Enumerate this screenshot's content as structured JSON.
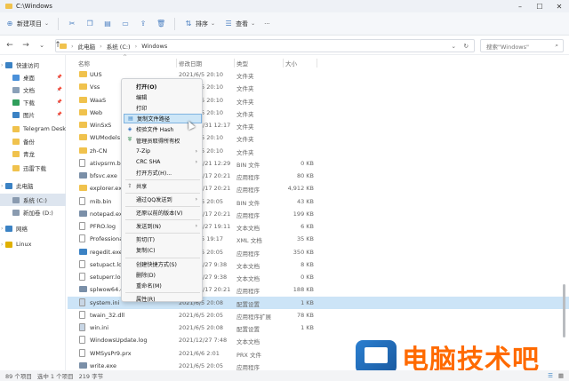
{
  "window": {
    "title": "C:\\Windows"
  },
  "toolbar": {
    "new_label": "新建项目",
    "sort_label": "排序",
    "view_label": "查看"
  },
  "address": {
    "crumbs": [
      "此电脑",
      "系统 (C:)",
      "Windows"
    ],
    "search_placeholder": "搜索\"Windows\""
  },
  "columns": {
    "name": "名称",
    "date": "修改日期",
    "type": "类型",
    "size": "大小"
  },
  "sidebar": [
    {
      "label": "快速访问",
      "icon": "star-icon",
      "color": "#3b82c4",
      "pin": false,
      "indent": 0
    },
    {
      "label": "桌面",
      "icon": "desktop-icon",
      "color": "#4a90d9",
      "pin": true,
      "indent": 1
    },
    {
      "label": "文档",
      "icon": "document-icon",
      "color": "#8aa0b8",
      "pin": true,
      "indent": 1
    },
    {
      "label": "下载",
      "icon": "download-icon",
      "color": "#2f9e5b",
      "pin": true,
      "indent": 1
    },
    {
      "label": "图片",
      "icon": "picture-icon",
      "color": "#3b82c4",
      "pin": true,
      "indent": 1
    },
    {
      "label": "Telegram Deskto",
      "icon": "folder-icon",
      "color": "#f0c24d",
      "pin": false,
      "indent": 1
    },
    {
      "label": "备份",
      "icon": "folder-icon",
      "color": "#f0c24d",
      "pin": false,
      "indent": 1
    },
    {
      "label": "青龙",
      "icon": "folder-icon",
      "color": "#f0c24d",
      "pin": false,
      "indent": 1
    },
    {
      "label": "迅雷下载",
      "icon": "folder-icon",
      "color": "#f0c24d",
      "pin": false,
      "indent": 1
    },
    {
      "label": "此电脑",
      "icon": "computer-icon",
      "color": "#3b82c4",
      "pin": false,
      "indent": 0
    },
    {
      "label": "系统 (C:)",
      "icon": "drive-icon",
      "color": "#8a9bb0",
      "pin": false,
      "indent": 1,
      "selected": true
    },
    {
      "label": "新加卷 (D:)",
      "icon": "drive-icon",
      "color": "#8a9bb0",
      "pin": false,
      "indent": 1
    },
    {
      "label": "网络",
      "icon": "network-icon",
      "color": "#3b82c4",
      "pin": false,
      "indent": 0
    },
    {
      "label": "Linux",
      "icon": "linux-icon",
      "color": "#e0b000",
      "pin": false,
      "indent": 0
    }
  ],
  "files": [
    {
      "name": "UUS",
      "date": "2021/6/5 20:10",
      "type": "文件夹",
      "size": "",
      "icon": "folder"
    },
    {
      "name": "Vss",
      "date": "2021/6/5 20:10",
      "type": "文件夹",
      "size": "",
      "icon": "folder"
    },
    {
      "name": "WaaS",
      "date": "2021/6/5 20:10",
      "type": "文件夹",
      "size": "",
      "icon": "folder"
    },
    {
      "name": "Web",
      "date": "2021/6/5 20:10",
      "type": "文件夹",
      "size": "",
      "icon": "folder"
    },
    {
      "name": "WinSxS",
      "date": "2021/12/31 12:17",
      "type": "文件夹",
      "size": "",
      "icon": "folder"
    },
    {
      "name": "WUModels",
      "date": "2021/6/5 20:10",
      "type": "文件夹",
      "size": "",
      "icon": "folder"
    },
    {
      "name": "zh-CN",
      "date": "2021/6/5 20:10",
      "type": "文件夹",
      "size": "",
      "icon": "folder"
    },
    {
      "name": "ativpsrm.bin",
      "date": "2021/12/21 12:29",
      "type": "BIN 文件",
      "size": "0 KB",
      "icon": "file"
    },
    {
      "name": "bfsvc.exe",
      "date": "2021/12/17 20:21",
      "type": "应用程序",
      "size": "80 KB",
      "icon": "exe"
    },
    {
      "name": "explorer.exe",
      "date": "2021/12/17 20:21",
      "type": "应用程序",
      "size": "4,912 KB",
      "icon": "explorer"
    },
    {
      "name": "mib.bin",
      "date": "2021/6/5 20:05",
      "type": "BIN 文件",
      "size": "43 KB",
      "icon": "file"
    },
    {
      "name": "notepad.exe",
      "date": "2021/12/17 20:21",
      "type": "应用程序",
      "size": "199 KB",
      "icon": "exe"
    },
    {
      "name": "PFRO.log",
      "date": "2021/12/27 19:11",
      "type": "文本文档",
      "size": "6 KB",
      "icon": "file"
    },
    {
      "name": "Professional.xml",
      "date": "2021/6/5 19:17",
      "type": "XML 文档",
      "size": "35 KB",
      "icon": "file"
    },
    {
      "name": "regedit.exe",
      "date": "2021/6/5 20:05",
      "type": "应用程序",
      "size": "350 KB",
      "icon": "regedit"
    },
    {
      "name": "setupact.log",
      "date": "2021/12/27 9:38",
      "type": "文本文档",
      "size": "8 KB",
      "icon": "file"
    },
    {
      "name": "setuperr.log",
      "date": "2021/12/27 9:38",
      "type": "文本文档",
      "size": "0 KB",
      "icon": "file"
    },
    {
      "name": "splwow64.exe",
      "date": "2021/12/17 20:21",
      "type": "应用程序",
      "size": "188 KB",
      "icon": "exe"
    },
    {
      "name": "system.ini",
      "date": "2021/6/5 20:08",
      "type": "配置设置",
      "size": "1 KB",
      "icon": "ini",
      "selected": true
    },
    {
      "name": "twain_32.dll",
      "date": "2021/6/5 20:05",
      "type": "应用程序扩展",
      "size": "78 KB",
      "icon": "file"
    },
    {
      "name": "win.ini",
      "date": "2021/6/5 20:08",
      "type": "配置设置",
      "size": "1 KB",
      "icon": "ini"
    },
    {
      "name": "WindowsUpdate.log",
      "date": "2021/12/27 7:48",
      "type": "文本文档",
      "size": "",
      "icon": "file"
    },
    {
      "name": "WMSysPr9.prx",
      "date": "2021/6/6 2:01",
      "type": "PRX 文件",
      "size": "",
      "icon": "file"
    },
    {
      "name": "write.exe",
      "date": "2021/6/5 20:05",
      "type": "应用程序",
      "size": "",
      "icon": "exe"
    }
  ],
  "context_menu": [
    {
      "label": "打开(O)",
      "bold": true,
      "icon": "",
      "arrow": false
    },
    {
      "label": "编辑",
      "icon": "",
      "arrow": false
    },
    {
      "label": "打印",
      "icon": "",
      "arrow": false
    },
    {
      "label": "复制文件路径",
      "icon": "copy-path-icon",
      "arrow": false,
      "highlight": true
    },
    {
      "label": "校验文件 Hash",
      "icon": "hash-icon",
      "arrow": false
    },
    {
      "label": "管理员取得所有权",
      "icon": "shield-icon",
      "arrow": false
    },
    {
      "label": "7-Zip",
      "icon": "",
      "arrow": true
    },
    {
      "label": "CRC SHA",
      "icon": "",
      "arrow": true
    },
    {
      "label": "打开方式(H)...",
      "icon": "",
      "arrow": false
    },
    {
      "label": "共享",
      "icon": "share-icon",
      "arrow": false,
      "sep_before": true
    },
    {
      "label": "通过QQ发送到",
      "icon": "",
      "arrow": true,
      "sep_before": true
    },
    {
      "label": "还原以前的版本(V)",
      "icon": "",
      "arrow": false,
      "sep_before": true
    },
    {
      "label": "发送到(N)",
      "icon": "",
      "arrow": true,
      "sep_before": true
    },
    {
      "label": "剪切(T)",
      "icon": "",
      "arrow": false,
      "sep_before": true
    },
    {
      "label": "复制(C)",
      "icon": "",
      "arrow": false
    },
    {
      "label": "创建快捷方式(S)",
      "icon": "",
      "arrow": false,
      "sep_before": true
    },
    {
      "label": "删除(D)",
      "icon": "",
      "arrow": false
    },
    {
      "label": "重命名(M)",
      "icon": "",
      "arrow": false
    },
    {
      "label": "属性(R)",
      "icon": "",
      "arrow": false,
      "sep_before": true
    }
  ],
  "status": {
    "count": "89 个项目",
    "selected": "选中 1 个项目",
    "size": "219 字节"
  },
  "watermark": {
    "text": "电脑技术吧"
  }
}
